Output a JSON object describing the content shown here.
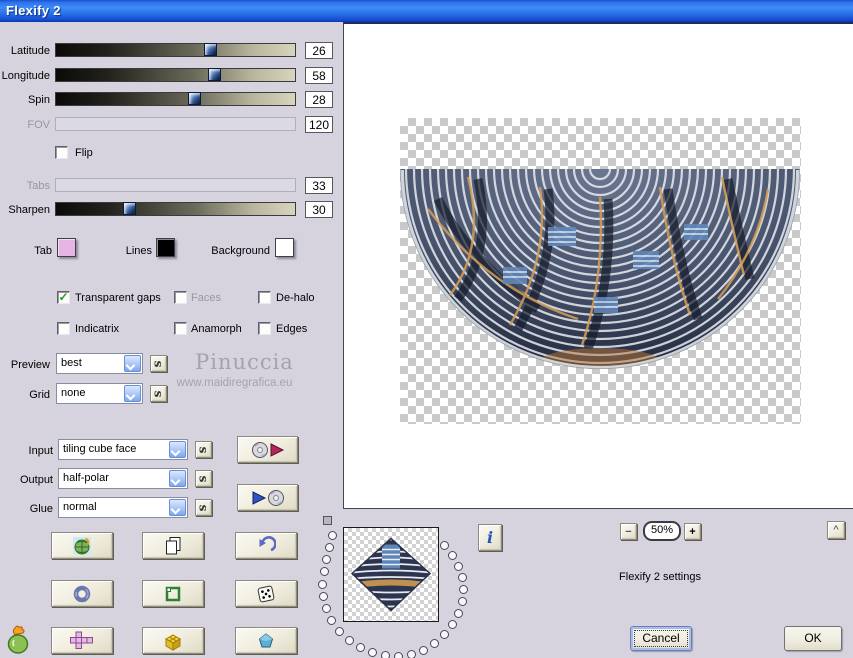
{
  "window": {
    "title": "Flexify 2"
  },
  "sliders": [
    {
      "label": "Latitude",
      "value": "26",
      "disabled": false
    },
    {
      "label": "Longitude",
      "value": "58",
      "disabled": false
    },
    {
      "label": "Spin",
      "value": "28",
      "disabled": false
    },
    {
      "label": "FOV",
      "value": "120",
      "disabled": true
    },
    {
      "label": "Tabs",
      "value": "33",
      "disabled": true
    },
    {
      "label": "Sharpen",
      "value": "30",
      "disabled": false
    }
  ],
  "flip": {
    "label": "Flip",
    "checked": false
  },
  "swatches": [
    {
      "label": "Tab",
      "color": "#e6b5e3"
    },
    {
      "label": "Lines",
      "color": "#000000"
    },
    {
      "label": "Background",
      "color": "#ffffff"
    }
  ],
  "checkboxes": [
    {
      "label": "Transparent gaps",
      "checked": true,
      "disabled": false
    },
    {
      "label": "Faces",
      "checked": false,
      "disabled": true
    },
    {
      "label": "De-halo",
      "checked": false,
      "disabled": false
    },
    {
      "label": "Indicatrix",
      "checked": false,
      "disabled": false
    },
    {
      "label": "Anamorph",
      "checked": false,
      "disabled": false
    },
    {
      "label": "Edges",
      "checked": false,
      "disabled": false
    }
  ],
  "dropdowns": [
    {
      "label": "Preview",
      "value": "best"
    },
    {
      "label": "Grid",
      "value": "none"
    },
    {
      "label": "Input",
      "value": "tiling cube face"
    },
    {
      "label": "Output",
      "value": "half-polar"
    },
    {
      "label": "Glue",
      "value": "normal"
    }
  ],
  "s_button": "s",
  "check_glyph": "✓",
  "watermark": {
    "line1": "Pinuccia",
    "line2": "www.maidiregrafica.eu"
  },
  "info_button": "i",
  "zoom_controls": {
    "minus": "−",
    "level": "50%",
    "plus": "+",
    "collapse": "^"
  },
  "caption": "Flexify 2 settings",
  "actions": {
    "cancel": "Cancel",
    "ok": "OK"
  },
  "colors": {
    "titlebar_blue": "#2f74ee",
    "dialog_bg": "#d6d3df",
    "button_face": "#f0ecdd",
    "tab_swatch": "#e6b5e3",
    "lines_swatch": "#000000",
    "background_swatch": "#ffffff",
    "check_green": "#1fa020",
    "slider_thumb_blue": "#2c4f86"
  },
  "icons": [
    "flaming-pear-logo",
    "globe",
    "copy-pages",
    "undo-arrow",
    "ring",
    "frame",
    "dice",
    "cube-net",
    "yellow-box",
    "gem",
    "disc-with-red-arrow",
    "blue-arrow-with-disc",
    "info"
  ]
}
